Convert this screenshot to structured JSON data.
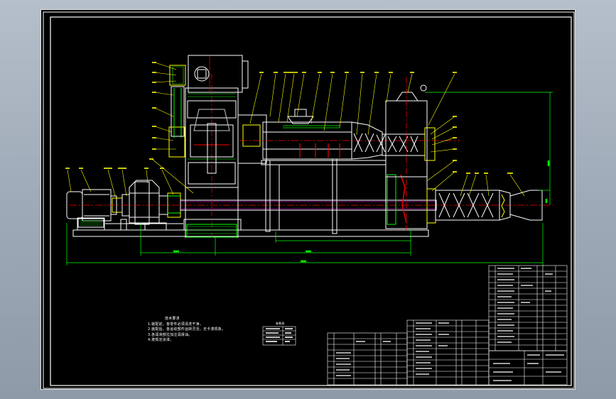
{
  "drawing": {
    "technical_requirements": {
      "heading": "技术要求",
      "lines": [
        "1.装配前，各零件必须清洗干净。",
        "2.装配后，各运动部件运转灵活，无卡滞现象。",
        "3.各润滑部位加注润滑油。",
        "4.按规定涂漆。"
      ]
    },
    "center_label": "参数表",
    "colors": {
      "outline": "#ffffff",
      "hidden": "#c8c8c8",
      "leader": "#ffff00",
      "dimension": "#00ff00",
      "centerline": "#ff0000",
      "hatch": "#00ff00",
      "section": "#ff00ff",
      "part_yellow": "#ffff00"
    }
  }
}
